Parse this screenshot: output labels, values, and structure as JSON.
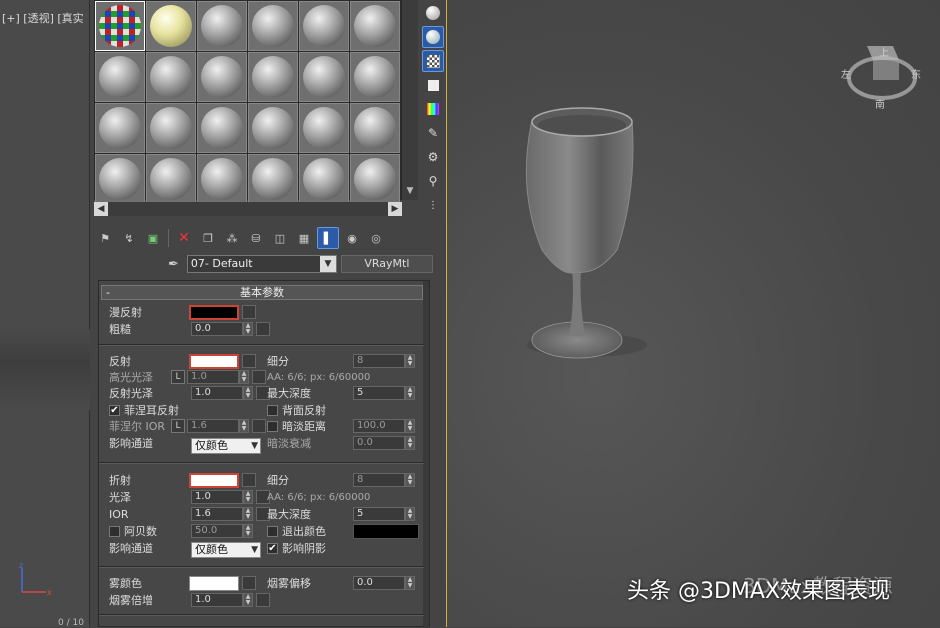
{
  "viewport": {
    "label": "[+] [透视] [真实",
    "bottom_text": "0 / 10"
  },
  "viewcube": {
    "top": "上",
    "left": "左",
    "right": "东",
    "bottom": "南"
  },
  "watermark": "头条 @3DMAX效果图表现",
  "watermark_behind": "3DMax教程资源",
  "material_name": "07- Default",
  "material_type": "VRayMtl",
  "rollout_title": "基本参数",
  "diffuse": {
    "label": "漫反射",
    "roughness_label": "粗糙",
    "roughness": "0.0"
  },
  "reflection": {
    "label": "反射",
    "hilight_label": "高光光泽",
    "hilight": "1.0",
    "gloss_label": "反射光泽",
    "gloss": "1.0",
    "fresnel_label": "菲涅耳反射",
    "fresnel_ior_label": "菲涅尔 IOR",
    "fresnel_ior": "1.6",
    "affect_label": "影响通道",
    "affect_value": "仅颜色",
    "subdiv_label": "细分",
    "subdiv": "8",
    "aa_text": "AA: 6/6; px: 6/60000",
    "max_depth_label": "最大深度",
    "max_depth": "5",
    "back_label": "背面反射",
    "dim_dist_label": "暗淡距离",
    "dim_dist": "100.0",
    "dim_falloff_label": "暗淡衰减",
    "dim_falloff": "0.0"
  },
  "refraction": {
    "label": "折射",
    "gloss_label": "光泽",
    "gloss": "1.0",
    "ior_label": "IOR",
    "ior": "1.6",
    "abbe_label": "阿贝数",
    "abbe": "50.0",
    "affect_label": "影响通道",
    "affect_value": "仅颜色",
    "subdiv_label": "细分",
    "subdiv": "8",
    "aa_text": "AA: 6/6; px: 6/60000",
    "max_depth_label": "最大深度",
    "max_depth": "5",
    "exit_label": "退出颜色",
    "shadow_label": "影响阴影"
  },
  "fog": {
    "color_label": "雾颜色",
    "mult_label": "烟雾倍增",
    "mult": "1.0",
    "bias_label": "烟雾偏移",
    "bias": "0.0"
  }
}
